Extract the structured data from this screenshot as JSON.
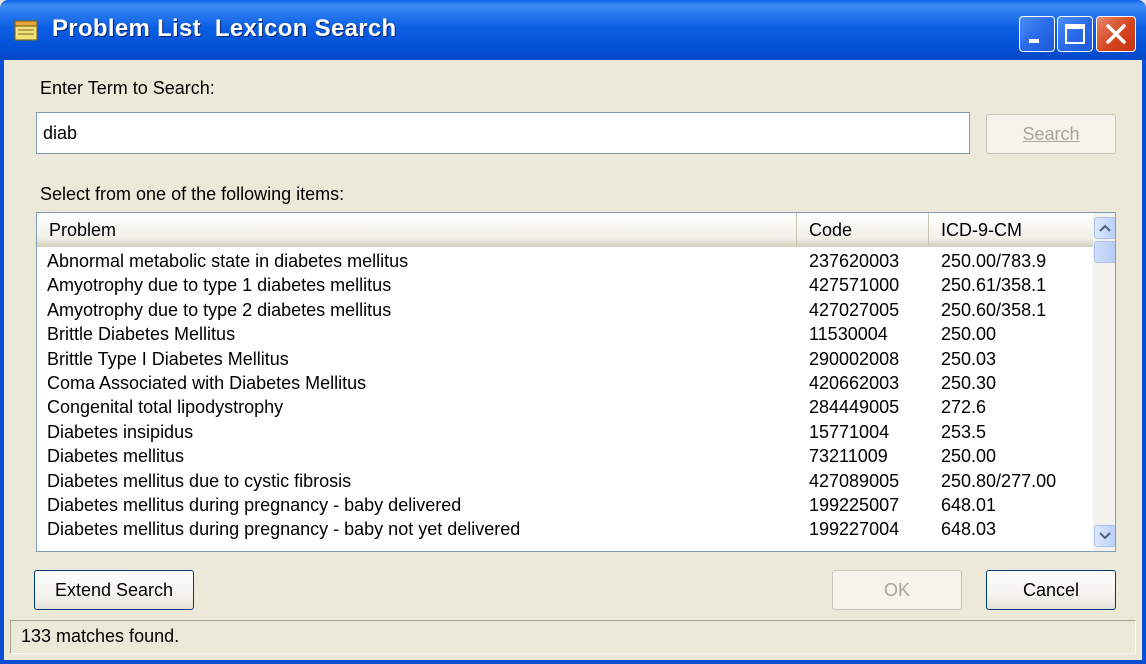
{
  "window": {
    "title": "Problem List  Lexicon Search",
    "icon": "notepad-icon",
    "controls": [
      "minimize-icon",
      "maximize-icon",
      "close-icon"
    ]
  },
  "search": {
    "label": "Enter Term to Search:",
    "value": "diab",
    "button_label": "Search",
    "button_enabled": false
  },
  "list": {
    "label": "Select from one of the following items:",
    "columns": [
      "Problem",
      "Code",
      "ICD-9-CM"
    ],
    "rows": [
      [
        "Abnormal metabolic state in diabetes mellitus",
        "237620003",
        "250.00/783.9"
      ],
      [
        "Amyotrophy due to type 1 diabetes mellitus",
        "427571000",
        "250.61/358.1"
      ],
      [
        "Amyotrophy due to type 2 diabetes mellitus",
        "427027005",
        "250.60/358.1"
      ],
      [
        "Brittle Diabetes Mellitus",
        "11530004",
        "250.00"
      ],
      [
        "Brittle Type I Diabetes Mellitus",
        "290002008",
        "250.03"
      ],
      [
        "Coma Associated with Diabetes Mellitus",
        "420662003",
        "250.30"
      ],
      [
        "Congenital total lipodystrophy",
        "284449005",
        "272.6"
      ],
      [
        "Diabetes insipidus",
        "15771004",
        "253.5"
      ],
      [
        "Diabetes mellitus",
        "73211009",
        "250.00"
      ],
      [
        "Diabetes mellitus due to cystic fibrosis",
        "427089005",
        "250.80/277.00"
      ],
      [
        "Diabetes mellitus during pregnancy - baby delivered",
        "199225007",
        "648.01"
      ],
      [
        "Diabetes mellitus during pregnancy - baby not yet delivered",
        "199227004",
        "648.03"
      ]
    ]
  },
  "buttons": {
    "extend": "Extend Search",
    "ok": "OK",
    "cancel": "Cancel"
  },
  "status": "133 matches found.",
  "colors": {
    "titlebar": "#0a5ee8",
    "dialog_bg": "#ece9d8",
    "disabled_text": "#a7a595"
  }
}
